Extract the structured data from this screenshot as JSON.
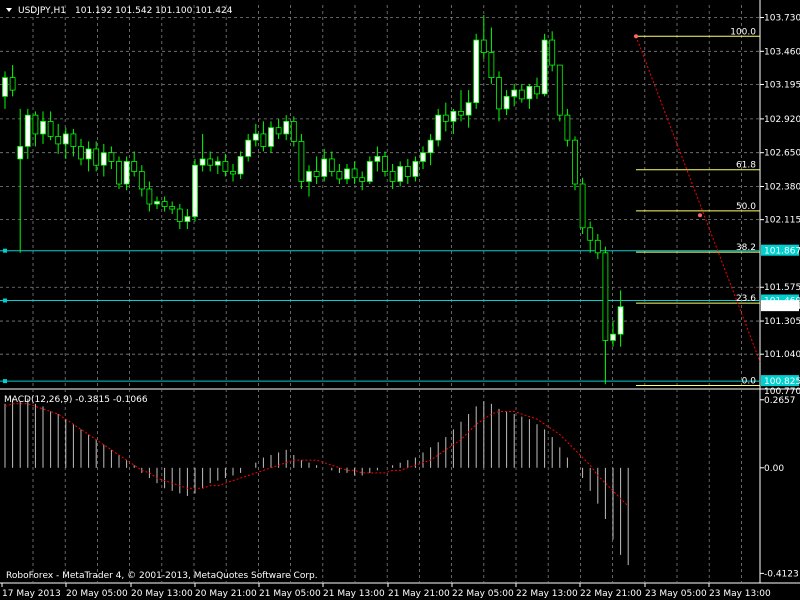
{
  "header": {
    "symbol": "USDJPY,H1",
    "ohlc": "101.192 101.542 101.100 101.424"
  },
  "footer": {
    "copyright": "RoboForex - MetaTrader 4, © 2001-2013, MetaQuotes Software Corp."
  },
  "macd": {
    "label": "MACD(12,26,9) -0.3815 -0.1066",
    "ticks": [
      {
        "value": 0.2657,
        "label": "0.2657"
      },
      {
        "value": 0.0,
        "label": "0.00"
      },
      {
        "value": -0.4123,
        "label": "-0.4123"
      }
    ]
  },
  "colors": {
    "background": "#000000",
    "grid": "#808080",
    "bull": "#ffffff",
    "bear": "#000000",
    "wick": "#00ff00",
    "level_line": "#00d0d0",
    "fib_line": "#ffff66",
    "trend_line": "#ff0000",
    "macd_hist": "#c0c0c0",
    "macd_signal": "#ff0000"
  },
  "chart_data": {
    "type": "candlestick",
    "symbol": "USDJPY",
    "timeframe": "H1",
    "ylim": [
      100.77,
      103.83
    ],
    "y_ticks": [
      103.73,
      103.46,
      103.195,
      102.92,
      102.65,
      102.38,
      102.115,
      101.575,
      101.305,
      101.04
    ],
    "y_tick_labels": [
      "103.730",
      "103.460",
      "103.195",
      "102.920",
      "102.650",
      "102.380",
      "102.115",
      "101.575",
      "101.305",
      "101.040"
    ],
    "x_labels": [
      "17 May 2013",
      "20 May 05:00",
      "20 May 13:00",
      "20 May 21:00",
      "21 May 05:00",
      "21 May 13:00",
      "21 May 21:00",
      "22 May 05:00",
      "22 May 13:00",
      "22 May 21:00",
      "23 May 05:00",
      "23 May 13:00"
    ],
    "horizontal_levels": [
      {
        "price": 101.867,
        "label": "101.867"
      },
      {
        "price": 101.469,
        "label": "101.469"
      },
      {
        "price": 100.825,
        "label": "100.825"
      }
    ],
    "bid_label": "101.424",
    "bid_price": 101.424,
    "bottom_tick": {
      "price": 100.77,
      "label": "100.770"
    },
    "fibonacci": {
      "high": 103.58,
      "low": 100.79,
      "levels": [
        {
          "ratio": 100.0,
          "label": "100.0"
        },
        {
          "ratio": 61.8,
          "label": "61.8"
        },
        {
          "ratio": 50.0,
          "label": "50.0"
        },
        {
          "ratio": 38.2,
          "label": "38.2"
        },
        {
          "ratio": 23.6,
          "label": "23.6"
        },
        {
          "ratio": 0.0,
          "label": "0.0"
        }
      ]
    },
    "trendline": {
      "from": {
        "bar": 121,
        "price": 103.58
      },
      "to": {
        "bar": 144,
        "price": 100.98
      }
    },
    "candles": [
      [
        103.1,
        103.3,
        103.0,
        103.25
      ],
      [
        103.25,
        103.35,
        103.1,
        103.15
      ],
      [
        102.6,
        103.0,
        101.85,
        102.7
      ],
      [
        102.7,
        103.0,
        102.6,
        102.95
      ],
      [
        102.95,
        102.98,
        102.7,
        102.8
      ],
      [
        102.8,
        102.98,
        102.72,
        102.9
      ],
      [
        102.9,
        102.98,
        102.75,
        102.78
      ],
      [
        102.78,
        102.88,
        102.64,
        102.72
      ],
      [
        102.72,
        102.85,
        102.6,
        102.8
      ],
      [
        102.8,
        102.84,
        102.62,
        102.7
      ],
      [
        102.7,
        102.76,
        102.55,
        102.6
      ],
      [
        102.6,
        102.74,
        102.5,
        102.68
      ],
      [
        102.68,
        102.74,
        102.5,
        102.55
      ],
      [
        102.55,
        102.72,
        102.46,
        102.65
      ],
      [
        102.65,
        102.7,
        102.52,
        102.58
      ],
      [
        102.58,
        102.62,
        102.36,
        102.4
      ],
      [
        102.4,
        102.62,
        102.35,
        102.58
      ],
      [
        102.58,
        102.66,
        102.46,
        102.5
      ],
      [
        102.5,
        102.55,
        102.3,
        102.36
      ],
      [
        102.36,
        102.42,
        102.18,
        102.24
      ],
      [
        102.24,
        102.3,
        102.2,
        102.26
      ],
      [
        102.26,
        102.3,
        102.18,
        102.22
      ],
      [
        102.22,
        102.26,
        102.16,
        102.2
      ],
      [
        102.2,
        102.24,
        102.04,
        102.1
      ],
      [
        102.1,
        102.2,
        102.04,
        102.14
      ],
      [
        102.14,
        102.6,
        102.1,
        102.55
      ],
      [
        102.55,
        102.8,
        102.5,
        102.6
      ],
      [
        102.6,
        102.66,
        102.5,
        102.55
      ],
      [
        102.55,
        102.62,
        102.48,
        102.58
      ],
      [
        102.58,
        102.64,
        102.46,
        102.5
      ],
      [
        102.5,
        102.56,
        102.42,
        102.48
      ],
      [
        102.48,
        102.66,
        102.44,
        102.62
      ],
      [
        102.62,
        102.8,
        102.58,
        102.75
      ],
      [
        102.75,
        102.88,
        102.7,
        102.8
      ],
      [
        102.8,
        102.9,
        102.66,
        102.7
      ],
      [
        102.7,
        102.9,
        102.65,
        102.85
      ],
      [
        102.85,
        102.92,
        102.76,
        102.8
      ],
      [
        102.8,
        102.95,
        102.75,
        102.9
      ],
      [
        102.9,
        102.94,
        102.7,
        102.74
      ],
      [
        102.74,
        102.8,
        102.36,
        102.42
      ],
      [
        102.42,
        102.55,
        102.3,
        102.5
      ],
      [
        102.5,
        102.62,
        102.4,
        102.46
      ],
      [
        102.46,
        102.68,
        102.42,
        102.6
      ],
      [
        102.6,
        102.66,
        102.46,
        102.5
      ],
      [
        102.5,
        102.56,
        102.4,
        102.44
      ],
      [
        102.44,
        102.56,
        102.4,
        102.52
      ],
      [
        102.52,
        102.58,
        102.4,
        102.45
      ],
      [
        102.45,
        102.5,
        102.35,
        102.42
      ],
      [
        102.42,
        102.62,
        102.4,
        102.58
      ],
      [
        102.58,
        102.7,
        102.5,
        102.62
      ],
      [
        102.62,
        102.66,
        102.46,
        102.5
      ],
      [
        102.5,
        102.56,
        102.36,
        102.42
      ],
      [
        102.42,
        102.58,
        102.38,
        102.54
      ],
      [
        102.54,
        102.6,
        102.4,
        102.46
      ],
      [
        102.46,
        102.62,
        102.42,
        102.58
      ],
      [
        102.58,
        102.7,
        102.52,
        102.65
      ],
      [
        102.65,
        102.8,
        102.55,
        102.75
      ],
      [
        102.75,
        103.0,
        102.7,
        102.95
      ],
      [
        102.95,
        103.05,
        102.82,
        102.9
      ],
      [
        102.9,
        103.0,
        102.8,
        102.98
      ],
      [
        102.98,
        103.15,
        102.9,
        102.95
      ],
      [
        102.95,
        103.15,
        102.85,
        103.05
      ],
      [
        103.05,
        103.6,
        103.0,
        103.55
      ],
      [
        103.55,
        103.75,
        103.4,
        103.45
      ],
      [
        103.45,
        103.65,
        103.2,
        103.25
      ],
      [
        103.25,
        103.3,
        102.9,
        103.0
      ],
      [
        103.0,
        103.15,
        102.95,
        103.1
      ],
      [
        103.1,
        103.2,
        103.02,
        103.15
      ],
      [
        103.15,
        103.2,
        103.05,
        103.08
      ],
      [
        103.08,
        103.2,
        103.0,
        103.18
      ],
      [
        103.18,
        103.25,
        103.08,
        103.12
      ],
      [
        103.12,
        103.6,
        103.1,
        103.55
      ],
      [
        103.55,
        103.62,
        103.3,
        103.35
      ],
      [
        103.35,
        103.3,
        102.9,
        102.95
      ],
      [
        102.95,
        103.0,
        102.7,
        102.75
      ],
      [
        102.75,
        102.78,
        102.35,
        102.4
      ],
      [
        102.4,
        102.45,
        102.0,
        102.05
      ],
      [
        102.05,
        102.1,
        101.85,
        101.95
      ],
      [
        101.95,
        102.0,
        101.8,
        101.85
      ],
      [
        101.85,
        101.9,
        100.8,
        101.15
      ],
      [
        101.15,
        101.3,
        101.1,
        101.2
      ],
      [
        101.2,
        101.55,
        101.1,
        101.42
      ]
    ],
    "macd_hist": [
      0.25,
      0.27,
      0.26,
      0.27,
      0.25,
      0.24,
      0.22,
      0.21,
      0.19,
      0.17,
      0.15,
      0.13,
      0.11,
      0.09,
      0.07,
      0.05,
      0.03,
      0.01,
      -0.02,
      -0.04,
      -0.06,
      -0.08,
      -0.09,
      -0.1,
      -0.11,
      -0.1,
      -0.08,
      -0.06,
      -0.05,
      -0.04,
      -0.03,
      -0.02,
      0.0,
      0.02,
      0.04,
      0.05,
      0.06,
      0.07,
      0.05,
      0.03,
      0.02,
      0.01,
      0.0,
      -0.01,
      -0.02,
      -0.02,
      -0.03,
      -0.03,
      -0.02,
      -0.01,
      0.0,
      0.01,
      0.02,
      0.03,
      0.04,
      0.06,
      0.08,
      0.1,
      0.12,
      0.15,
      0.18,
      0.21,
      0.24,
      0.26,
      0.25,
      0.23,
      0.22,
      0.21,
      0.2,
      0.19,
      0.17,
      0.15,
      0.12,
      0.08,
      0.04,
      0.0,
      -0.04,
      -0.09,
      -0.14,
      -0.2,
      -0.28,
      -0.34,
      -0.38
    ],
    "macd_signal": [
      0.24,
      0.25,
      0.25,
      0.25,
      0.24,
      0.23,
      0.22,
      0.21,
      0.19,
      0.17,
      0.15,
      0.13,
      0.11,
      0.09,
      0.07,
      0.05,
      0.03,
      0.01,
      -0.01,
      -0.02,
      -0.04,
      -0.05,
      -0.06,
      -0.07,
      -0.08,
      -0.08,
      -0.08,
      -0.07,
      -0.07,
      -0.06,
      -0.05,
      -0.04,
      -0.03,
      -0.02,
      -0.01,
      0.0,
      0.01,
      0.02,
      0.03,
      0.03,
      0.03,
      0.03,
      0.02,
      0.01,
      0.0,
      -0.01,
      -0.01,
      -0.02,
      -0.02,
      -0.02,
      -0.02,
      -0.01,
      -0.01,
      0.0,
      0.01,
      0.02,
      0.03,
      0.05,
      0.07,
      0.09,
      0.11,
      0.14,
      0.17,
      0.19,
      0.21,
      0.22,
      0.22,
      0.22,
      0.21,
      0.2,
      0.19,
      0.17,
      0.15,
      0.13,
      0.1,
      0.07,
      0.04,
      0.01,
      -0.03,
      -0.06,
      -0.09,
      -0.12,
      -0.15
    ]
  }
}
